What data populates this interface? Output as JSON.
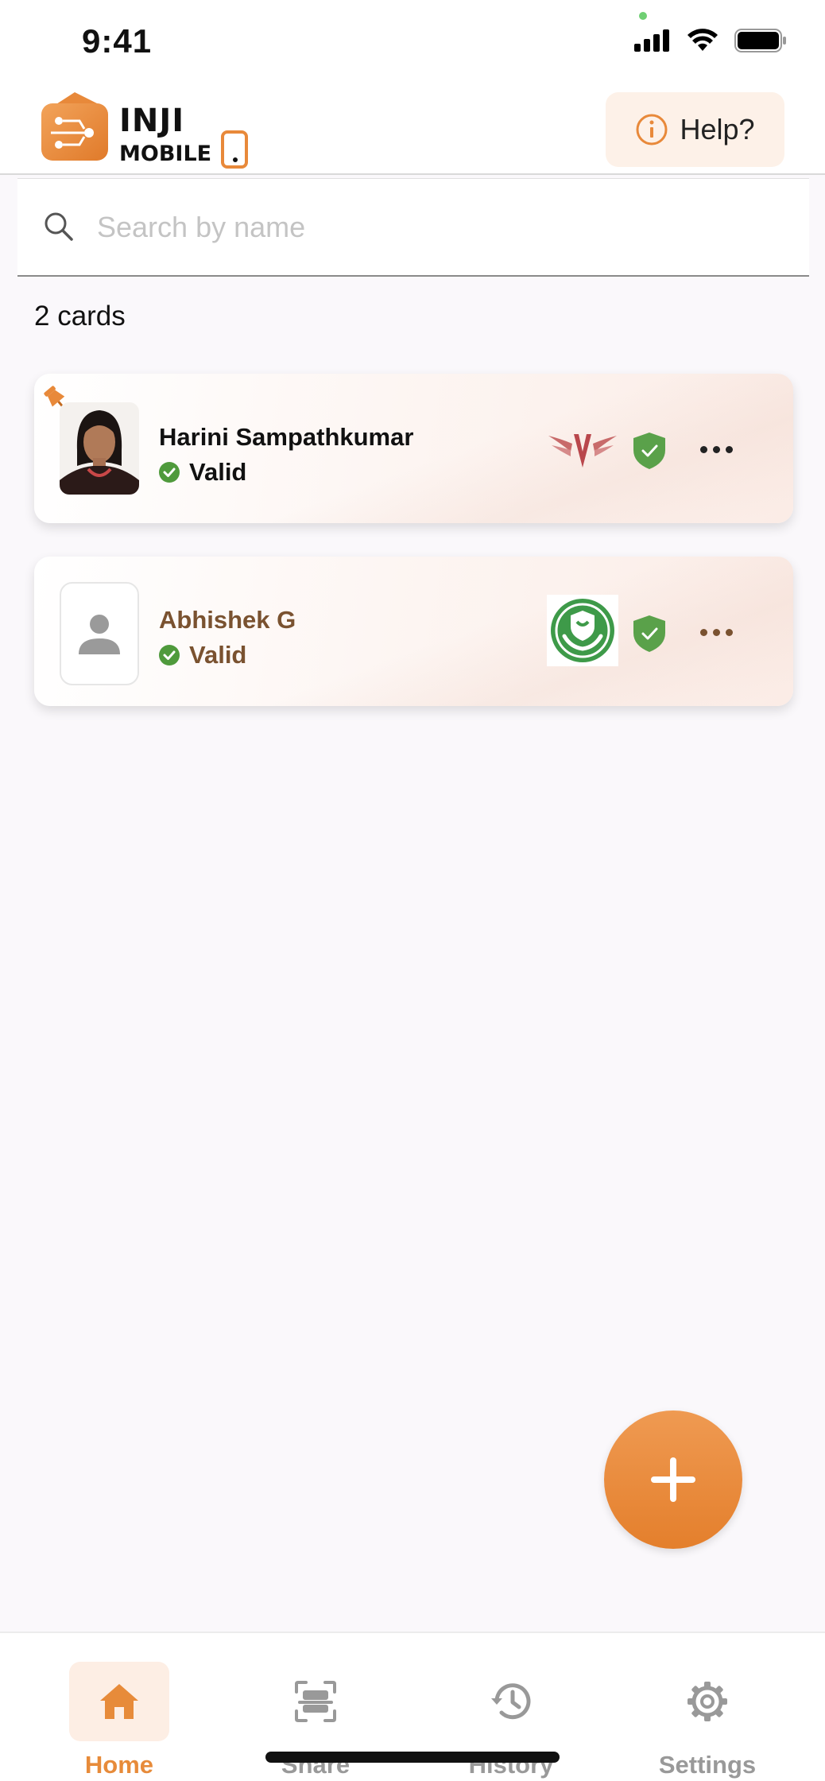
{
  "status_bar": {
    "time": "9:41"
  },
  "header": {
    "logo_text_top": "INJI",
    "logo_text_bottom": "MOBILE",
    "help_label": "Help?"
  },
  "search": {
    "placeholder": "Search by name",
    "value": ""
  },
  "card_count": "2 cards",
  "cards": [
    {
      "name": "Harini Sampathkumar",
      "status": "Valid",
      "pinned": true,
      "has_photo": true,
      "issuer_icon": "wings-logo-icon"
    },
    {
      "name": "Abhishek G",
      "status": "Valid",
      "pinned": false,
      "has_photo": false,
      "issuer_icon": "green-shield-hands-logo-icon"
    }
  ],
  "nav": [
    {
      "label": "Home",
      "icon": "home-icon",
      "active": true
    },
    {
      "label": "Share",
      "icon": "scan-icon",
      "active": false
    },
    {
      "label": "History",
      "icon": "history-icon",
      "active": false
    },
    {
      "label": "Settings",
      "icon": "gear-icon",
      "active": false
    }
  ],
  "colors": {
    "accent": "#e78b3a",
    "valid": "#4f9a3c",
    "shield": "#5aa14a",
    "brown_text": "#7a5230"
  }
}
